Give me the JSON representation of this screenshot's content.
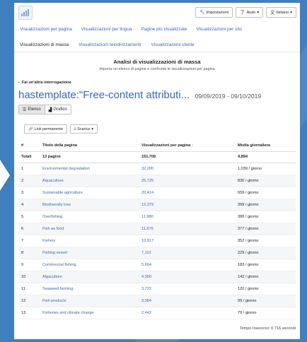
{
  "topbar": {
    "buttons": [
      {
        "label": "Impostazioni",
        "icon": "wrench-icon"
      },
      {
        "label": "Aiuto",
        "icon": "question-icon"
      },
      {
        "label": "Italiano",
        "icon": "translate-icon"
      }
    ]
  },
  "nav_primary": [
    "Visualizzazioni per pagina",
    "Visualizzazioni per lingua",
    "Pagine più visualizzate",
    "Visualizzazioni per sito"
  ],
  "nav_secondary": [
    "Visualizzazioni di massa",
    "Visualizzazioni reindirizzamenti",
    "Visualizzazioni utente"
  ],
  "heading": {
    "title": "Analisi di visualizzazioni di massa",
    "subtitle": "Importa un elenco di pagine e confronta le visualizzazioni per pagina"
  },
  "back_link": "Fai un'altra interrogazione",
  "query": {
    "title": "hastemplate:\"Free-content attributi...",
    "date_range": "09/09/2019 - 09/10/2019"
  },
  "view_toggle": {
    "list": "Elenco",
    "chart": "Grafico"
  },
  "actions": {
    "permalink": "Link permanente",
    "download": "Scarica"
  },
  "table": {
    "headers": [
      "#",
      "Titolo della pagina",
      "Visualizzazioni per pagina",
      "Media giornaliera"
    ],
    "totals": {
      "label": "Totali",
      "pages": "13 pagine",
      "views": "151,706",
      "avg": "4,894"
    },
    "rows": [
      {
        "n": "1",
        "title": "Environmental degradation",
        "views": "32,200",
        "avg": "1,039 / giorno"
      },
      {
        "n": "2",
        "title": "Aquaculture",
        "views": "25,725",
        "avg": "830 / giorno"
      },
      {
        "n": "3",
        "title": "Sustainable agriculture",
        "views": "20,414",
        "avg": "659 / giorno"
      },
      {
        "n": "4",
        "title": "Biodiversity loss",
        "views": "12,379",
        "avg": "399 / giorno"
      },
      {
        "n": "5",
        "title": "Overfishing",
        "views": "11,980",
        "avg": "386 / giorno"
      },
      {
        "n": "6",
        "title": "Fish as food",
        "views": "11,676",
        "avg": "377 / giorno"
      },
      {
        "n": "7",
        "title": "Fishery",
        "views": "10,917",
        "avg": "352 / giorno"
      },
      {
        "n": "8",
        "title": "Fishing vessel",
        "views": "7,112",
        "avg": "229 / giorno"
      },
      {
        "n": "9",
        "title": "Commercial fishing",
        "views": "5,664",
        "avg": "183 / giorno"
      },
      {
        "n": "10",
        "title": "Algaculture",
        "views": "4,390",
        "avg": "142 / giorno"
      },
      {
        "n": "11",
        "title": "Seaweed farming",
        "views": "3,722",
        "avg": "120 / giorno"
      },
      {
        "n": "12",
        "title": "Fish products",
        "views": "3,084",
        "avg": "99 / giorno"
      },
      {
        "n": "13",
        "title": "Fisheries and climate change",
        "views": "2,442",
        "avg": "79 / giorno"
      }
    ]
  },
  "footer": "Tempo trascorso: 0.716 secondi",
  "colors": {
    "background": "#3f7fc0",
    "link": "#3366cc"
  }
}
